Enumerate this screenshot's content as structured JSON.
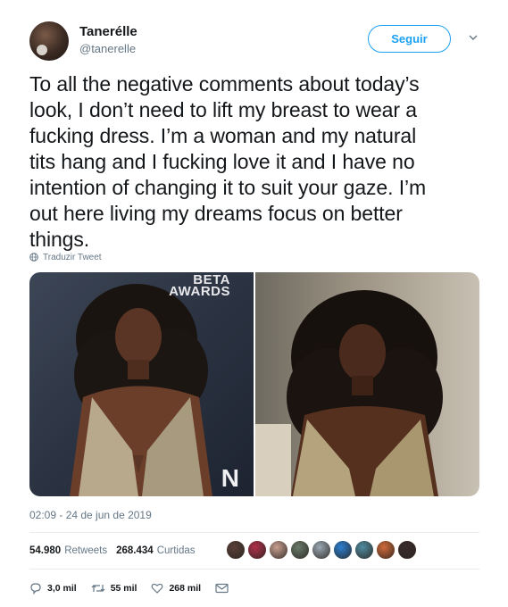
{
  "author": {
    "name": "Tanerélle",
    "handle": "@tanerelle"
  },
  "follow_label": "Seguir",
  "tweet": {
    "text": "To all the negative comments about today’s\nlook, I don’t need to lift my breast to wear a\nfucking dress. I’m a woman and my natural\ntits hang and I fucking love it and I have no\nintention of changing it to suit your gaze. I’m\nout here living my dreams focus on better\nthings.",
    "translate_label": "Traduzir Tweet",
    "timestamp": "02:09 - 24 de jun de 2019"
  },
  "media": {
    "left_backdrop_text": "BETA\nAWARDS",
    "left_corner_letter": "N"
  },
  "stats": {
    "retweets_count": "54.980",
    "retweets_label": "Retweets",
    "likes_count": "268.434",
    "likes_label": "Curtidas",
    "liker_colors": [
      "#5a4038",
      "#b0304a",
      "#c8a090",
      "#6a7c6a",
      "#9aa8b4",
      "#2b7fd1",
      "#4f8ca0",
      "#d06a3a",
      "#3a2c28"
    ]
  },
  "actions": {
    "replies": "3,0 mil",
    "retweets": "55 mil",
    "likes": "268 mil"
  },
  "colors": {
    "accent": "#1da1f2",
    "secondary_text": "#657786",
    "divider": "#e6ecf0"
  }
}
